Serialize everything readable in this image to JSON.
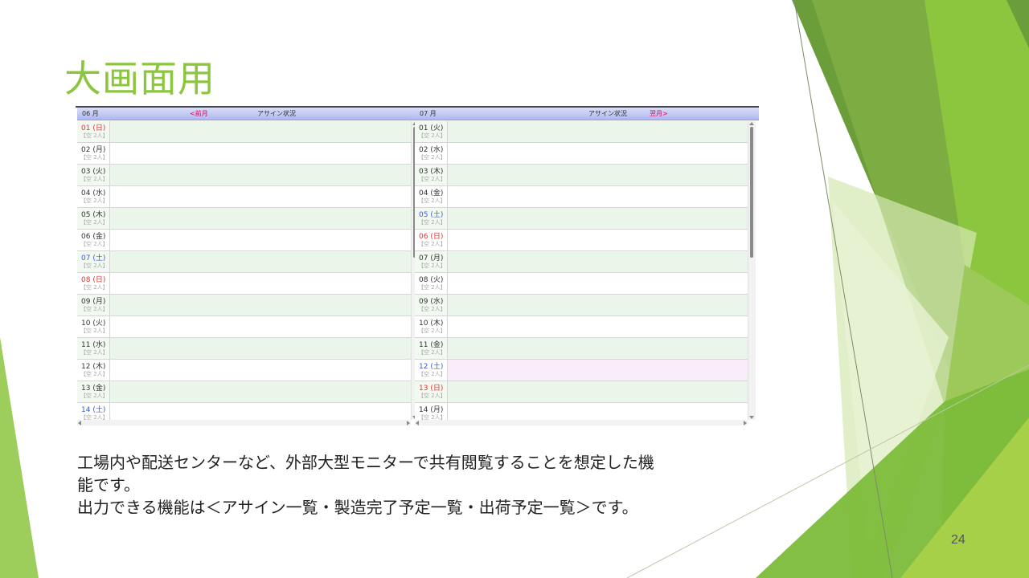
{
  "slide": {
    "title": "大画面用",
    "description_lines": [
      "工場内や配送センターなど、外部大型モニターで共有閲覧することを想定した機",
      "能です。",
      "出力できる機能は＜アサイン一覧・製造完了予定一覧・出荷予定一覧＞です。"
    ],
    "page_number": "24",
    "accent_color": "#8cc63e"
  },
  "calendar": {
    "left": {
      "month": "06 月",
      "status_label": "アサイン状況",
      "nav_label": "<前月",
      "days": [
        {
          "label": "01 (日)",
          "kind": "sun",
          "slot": "【空 2人】"
        },
        {
          "label": "02 (月)",
          "kind": "weekday",
          "slot": "【空 2人】"
        },
        {
          "label": "03 (火)",
          "kind": "weekday",
          "slot": "【空 2人】"
        },
        {
          "label": "04 (水)",
          "kind": "weekday",
          "slot": "【空 2人】"
        },
        {
          "label": "05 (木)",
          "kind": "weekday",
          "slot": "【空 2人】"
        },
        {
          "label": "06 (金)",
          "kind": "weekday",
          "slot": "【空 2人】"
        },
        {
          "label": "07 (土)",
          "kind": "sat",
          "slot": "【空 2人】"
        },
        {
          "label": "08 (日)",
          "kind": "sun",
          "slot": "【空 2人】"
        },
        {
          "label": "09 (月)",
          "kind": "weekday",
          "slot": "【空 2人】"
        },
        {
          "label": "10 (火)",
          "kind": "weekday",
          "slot": "【空 2人】"
        },
        {
          "label": "11 (水)",
          "kind": "weekday",
          "slot": "【空 2人】"
        },
        {
          "label": "12 (木)",
          "kind": "weekday",
          "slot": "【空 2人】"
        },
        {
          "label": "13 (金)",
          "kind": "weekday",
          "slot": "【空 2人】"
        },
        {
          "label": "14 (土)",
          "kind": "sat",
          "slot": "【空 2人】"
        }
      ]
    },
    "right": {
      "month": "07 月",
      "status_label": "アサイン状況",
      "nav_label": "翌月>",
      "days": [
        {
          "label": "01 (火)",
          "kind": "weekday",
          "slot": "【空 2人】"
        },
        {
          "label": "02 (水)",
          "kind": "weekday",
          "slot": "【空 2人】"
        },
        {
          "label": "03 (木)",
          "kind": "weekday",
          "slot": "【空 2人】"
        },
        {
          "label": "04 (金)",
          "kind": "weekday",
          "slot": "【空 2人】"
        },
        {
          "label": "05 (土)",
          "kind": "sat",
          "slot": "【空 2人】"
        },
        {
          "label": "06 (日)",
          "kind": "sun",
          "slot": "【空 2人】"
        },
        {
          "label": "07 (月)",
          "kind": "weekday",
          "slot": "【空 2人】"
        },
        {
          "label": "08 (火)",
          "kind": "weekday",
          "slot": "【空 2人】"
        },
        {
          "label": "09 (水)",
          "kind": "weekday",
          "slot": "【空 2人】"
        },
        {
          "label": "10 (木)",
          "kind": "weekday",
          "slot": "【空 2人】"
        },
        {
          "label": "11 (金)",
          "kind": "weekday",
          "slot": "【空 2人】"
        },
        {
          "label": "12 (土)",
          "kind": "sat",
          "slot": "【空 2人】",
          "highlight": true
        },
        {
          "label": "13 (日)",
          "kind": "sun",
          "slot": "【空 2人】"
        },
        {
          "label": "14 (月)",
          "kind": "weekday",
          "slot": "【空 2人】"
        }
      ]
    }
  }
}
